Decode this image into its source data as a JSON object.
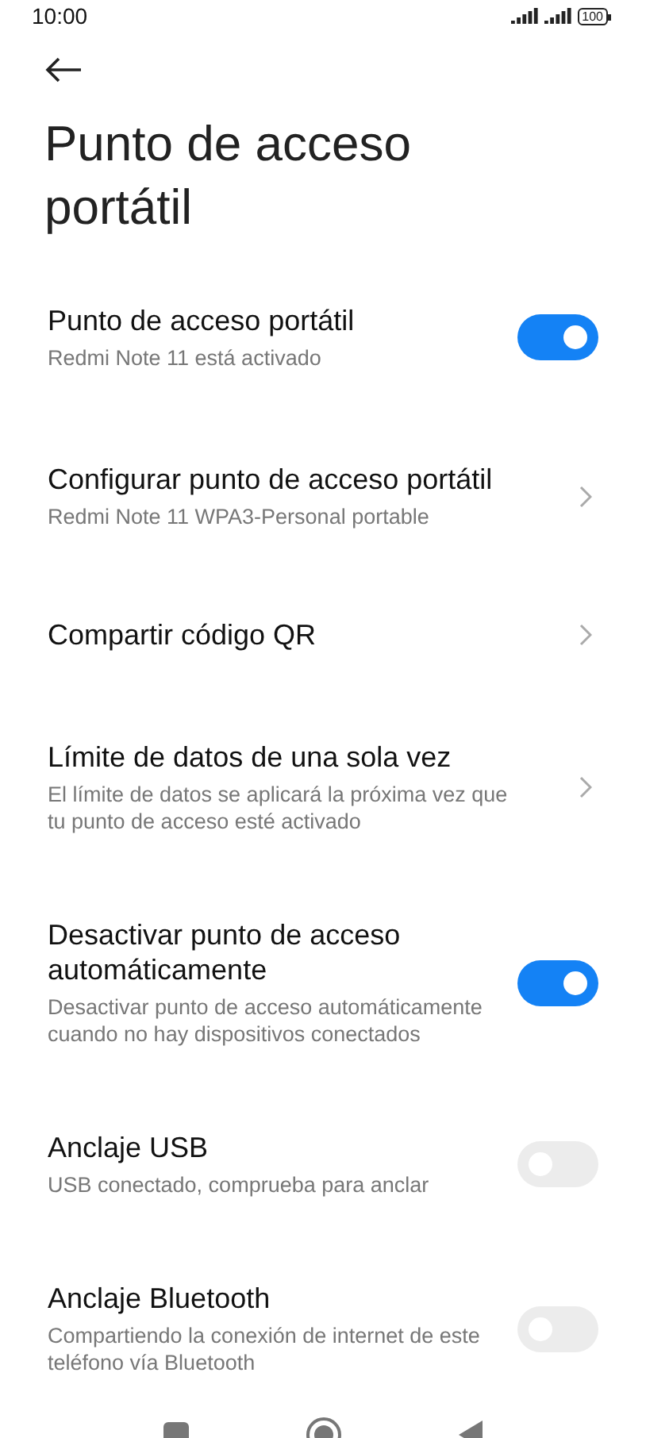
{
  "status_bar": {
    "time": "10:00",
    "battery": "100"
  },
  "title": "Punto de acceso portátil",
  "settings": [
    {
      "kind": "toggle",
      "title": "Punto de acceso portátil",
      "subtitle": "Redmi Note 11 está activado",
      "on": true,
      "disabled": false
    },
    {
      "kind": "link",
      "title": "Configurar punto de acceso portátil",
      "subtitle": "Redmi Note 11 WPA3-Personal portable"
    },
    {
      "kind": "link",
      "title": "Compartir código QR"
    },
    {
      "kind": "link",
      "title": "Límite de datos de una sola vez",
      "subtitle": "El límite de datos se aplicará la próxima vez que tu punto de acceso esté activado"
    },
    {
      "kind": "toggle",
      "title": "Desactivar punto de acceso automáticamente",
      "subtitle": "Desactivar punto de acceso automáticamente cuando no hay dispositivos conectados",
      "on": true,
      "disabled": false
    },
    {
      "kind": "toggle",
      "title": "Anclaje USB",
      "subtitle": "USB conectado, comprueba para anclar",
      "on": false,
      "disabled": true
    },
    {
      "kind": "toggle",
      "title": "Anclaje Bluetooth",
      "subtitle": "Compartiendo la conexión de internet de este teléfono vía Bluetooth",
      "on": false,
      "disabled": true
    }
  ]
}
